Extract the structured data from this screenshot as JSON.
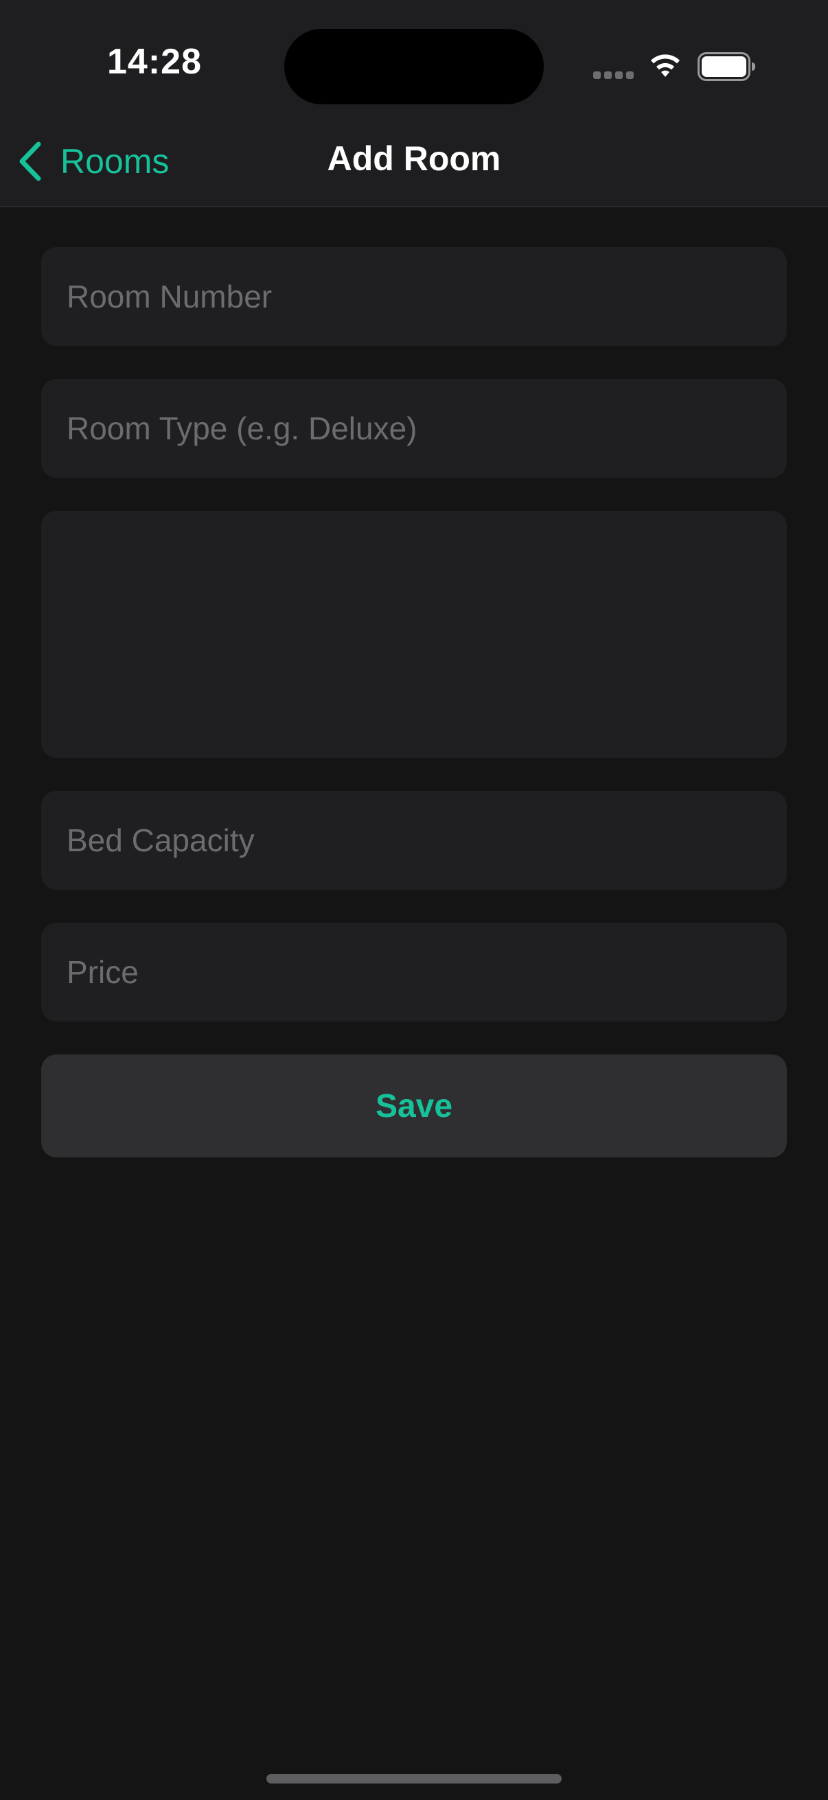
{
  "status_bar": {
    "time": "14:28",
    "wifi_icon": "wifi-icon",
    "battery_icon": "battery-icon"
  },
  "nav": {
    "back_label": "Rooms",
    "back_icon": "chevron-left-icon",
    "title": "Add Room"
  },
  "form": {
    "room_number": {
      "value": "",
      "placeholder": "Room Number"
    },
    "room_type": {
      "value": "",
      "placeholder": "Room Type (e.g. Deluxe)"
    },
    "description": {
      "value": "",
      "placeholder": ""
    },
    "bed_capacity": {
      "value": "",
      "placeholder": "Bed Capacity"
    },
    "price": {
      "value": "",
      "placeholder": "Price"
    },
    "save_label": "Save"
  },
  "colors": {
    "accent": "#17c29a",
    "background": "#141414",
    "field_background": "#1f1f21",
    "button_background": "#2f2f31",
    "placeholder": "#6c6c70"
  }
}
